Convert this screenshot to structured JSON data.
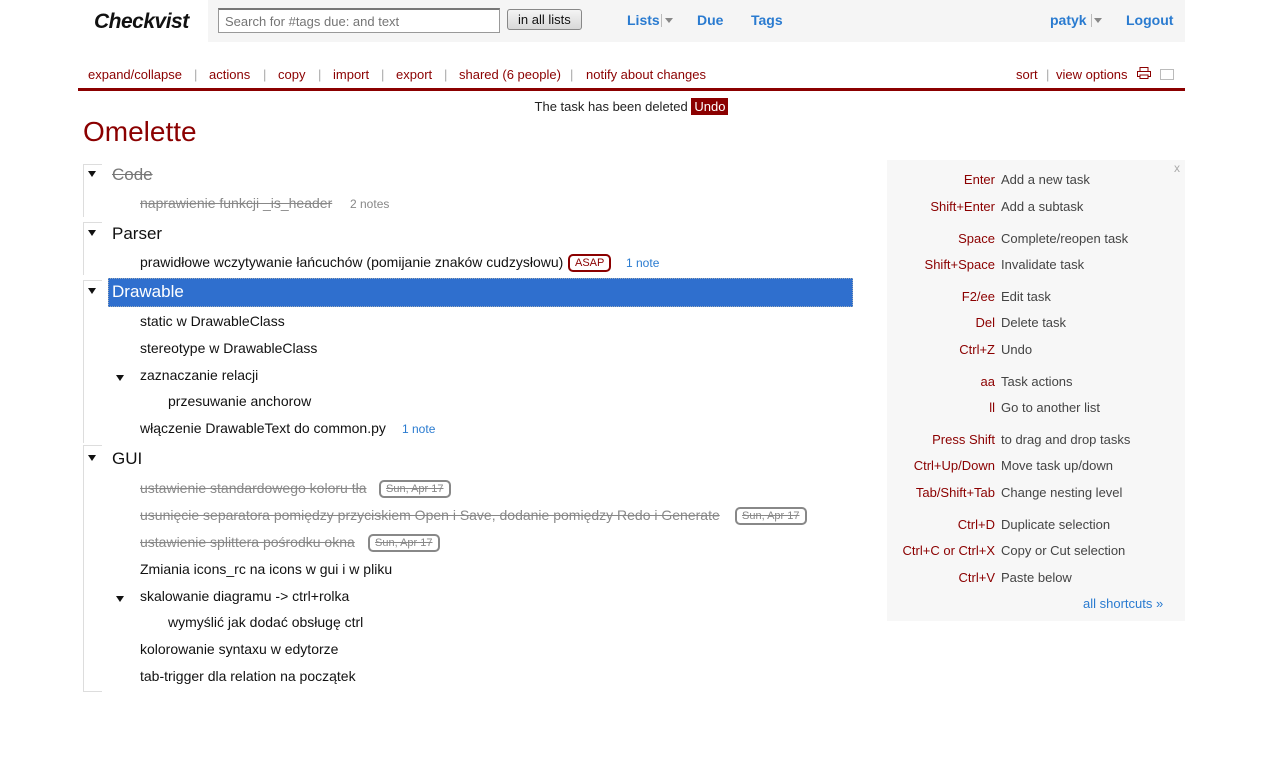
{
  "header": {
    "logo": "Checkvist",
    "search_placeholder": "Search for #tags due: and text",
    "search_button": "in all lists",
    "nav": {
      "lists": "Lists",
      "due": "Due",
      "tags": "Tags"
    },
    "user": "patyk",
    "logout": "Logout"
  },
  "toolbar": {
    "left": [
      "expand/collapse",
      "actions",
      "copy",
      "import",
      "export",
      "shared (6 people)",
      "notify about changes"
    ],
    "sort": "sort",
    "view_options": "view options"
  },
  "message": {
    "text": "The task has been deleted",
    "undo": "Undo"
  },
  "list": {
    "title": "Omelette",
    "groups": [
      {
        "title": "Code",
        "done": true,
        "tasks": [
          {
            "text": "naprawienie funkcji _is_header",
            "done": true,
            "notes": "2 notes"
          }
        ]
      },
      {
        "title": "Parser",
        "done": false,
        "tasks": [
          {
            "text": "prawidłowe wczytywanie łańcuchów (pomijanie znaków cudzysłowu)",
            "tag": "ASAP",
            "note": "1 note"
          }
        ]
      },
      {
        "title": "Drawable",
        "done": false,
        "selected": true,
        "tasks": [
          {
            "text": "static w DrawableClass"
          },
          {
            "text": "stereotype w DrawableClass"
          },
          {
            "text": "zaznaczanie relacji"
          },
          {
            "text": "przesuwanie anchorow"
          },
          {
            "text": "włączenie DrawableText do common.py",
            "note": "1 note"
          }
        ]
      },
      {
        "title": "GUI",
        "done": false,
        "tasks": [
          {
            "text": "ustawienie standardowego koloru tła",
            "done": true,
            "date": "Sun, Apr 17"
          },
          {
            "text": "usunięcie separatora pomiędzy przyciskiem Open i Save, dodanie pomiędzy Redo i Generate",
            "done": true,
            "date": "Sun, Apr 17"
          },
          {
            "text": "ustawienie splittera pośrodku okna",
            "done": true,
            "date": "Sun, Apr 17"
          },
          {
            "text": "Zmiania icons_rc na icons w gui i w pliku"
          },
          {
            "text": "skalowanie diagramu -> ctrl+rolka"
          },
          {
            "text": "wymyślić jak dodać obsługę ctrl"
          },
          {
            "text": "kolorowanie syntaxu w edytorze"
          },
          {
            "text": "tab-trigger dla relation na początek"
          }
        ]
      }
    ]
  },
  "shortcuts": {
    "close": "x",
    "items": [
      {
        "key": "Enter",
        "desc": "Add a new task"
      },
      {
        "key": "Shift+Enter",
        "desc": "Add a subtask"
      },
      {
        "key": "Space",
        "desc": "Complete/reopen task"
      },
      {
        "key": "Shift+Space",
        "desc": "Invalidate task"
      },
      {
        "key": "F2/ee",
        "desc": "Edit task"
      },
      {
        "key": "Del",
        "desc": "Delete task"
      },
      {
        "key": "Ctrl+Z",
        "desc": "Undo"
      },
      {
        "key": "aa",
        "desc": "Task actions"
      },
      {
        "key": "ll",
        "desc": "Go to another list"
      },
      {
        "key": "Press Shift",
        "desc": "to drag and drop tasks"
      },
      {
        "key": "Ctrl+Up/Down",
        "desc": "Move task up/down"
      },
      {
        "key": "Tab/Shift+Tab",
        "desc": "Change nesting level"
      },
      {
        "key": "Ctrl+D",
        "desc": "Duplicate selection"
      },
      {
        "key": "Ctrl+C or Ctrl+X",
        "desc": "Copy or Cut selection"
      },
      {
        "key": "Ctrl+V",
        "desc": "Paste below"
      }
    ],
    "all": "all shortcuts »"
  },
  "colors": {
    "brand": "#8b0000",
    "link": "#2a7bd0",
    "selected": "#2f6fce"
  }
}
